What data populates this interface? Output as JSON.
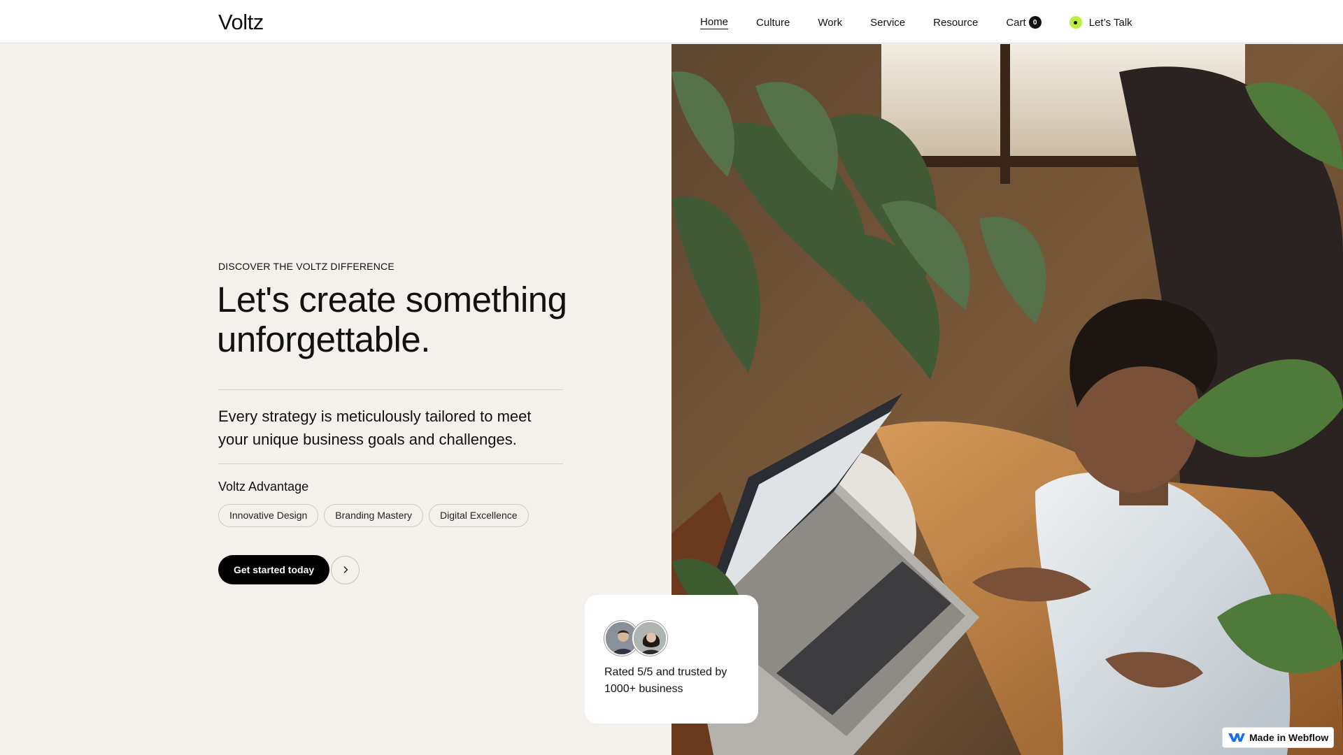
{
  "header": {
    "logo": "Voltz",
    "nav": [
      {
        "label": "Home",
        "active": true
      },
      {
        "label": "Culture"
      },
      {
        "label": "Work"
      },
      {
        "label": "Service"
      },
      {
        "label": "Resource"
      }
    ],
    "cart": {
      "label": "Cart",
      "count": "0"
    },
    "talk": {
      "label": "Let’s Talk",
      "dot_color": "#b9ef3f"
    }
  },
  "hero": {
    "eyebrow": "DISCOVER THE VOLTZ DIFFERENCE",
    "headline": "Let's create something unforgettable.",
    "lead": "Every strategy is meticulously tailored to meet your unique business goals and challenges.",
    "advantage_title": "Voltz Advantage",
    "pills": [
      "Innovative Design",
      "Branding Mastery",
      "Digital Excellence"
    ],
    "cta_label": "Get started today",
    "cta_icon": "chevron-right-icon",
    "image_subject": "person-with-laptop-on-leather-sofa-among-plants"
  },
  "rating": {
    "text": "Rated 5/5 and trusted by 1000+ business"
  },
  "badge": {
    "label": "Made in Webflow",
    "icon": "webflow-logo-icon",
    "brand_color": "#146ef5"
  }
}
